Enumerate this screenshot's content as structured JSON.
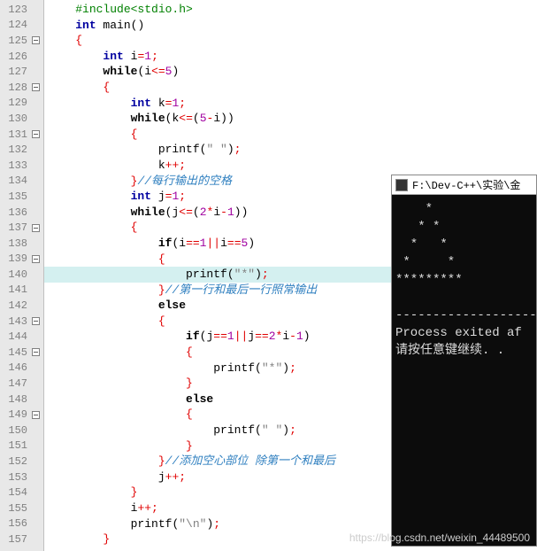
{
  "lines": [
    {
      "n": 123,
      "fold": false,
      "hl": false,
      "tokens": [
        [
          "    ",
          ""
        ],
        [
          "#include<stdio.h>",
          "preproc"
        ]
      ]
    },
    {
      "n": 124,
      "fold": false,
      "hl": false,
      "tokens": [
        [
          "    ",
          ""
        ],
        [
          "int",
          "type"
        ],
        [
          " main",
          ""
        ],
        [
          "()",
          "paren"
        ]
      ]
    },
    {
      "n": 125,
      "fold": true,
      "hl": false,
      "tokens": [
        [
          "    ",
          ""
        ],
        [
          "{",
          "brace"
        ]
      ]
    },
    {
      "n": 126,
      "fold": false,
      "hl": false,
      "tokens": [
        [
          "        ",
          ""
        ],
        [
          "int",
          "type"
        ],
        [
          " i",
          ""
        ],
        [
          "=",
          "op"
        ],
        [
          "1",
          "num"
        ],
        [
          ";",
          "op"
        ]
      ]
    },
    {
      "n": 127,
      "fold": false,
      "hl": false,
      "tokens": [
        [
          "        ",
          ""
        ],
        [
          "while",
          "keyword"
        ],
        [
          "(",
          "paren"
        ],
        [
          "i",
          ""
        ],
        [
          "<=",
          "op"
        ],
        [
          "5",
          "num"
        ],
        [
          ")",
          "paren"
        ]
      ]
    },
    {
      "n": 128,
      "fold": true,
      "hl": false,
      "tokens": [
        [
          "        ",
          ""
        ],
        [
          "{",
          "brace"
        ]
      ]
    },
    {
      "n": 129,
      "fold": false,
      "hl": false,
      "tokens": [
        [
          "            ",
          ""
        ],
        [
          "int",
          "type"
        ],
        [
          " k",
          ""
        ],
        [
          "=",
          "op"
        ],
        [
          "1",
          "num"
        ],
        [
          ";",
          "op"
        ]
      ]
    },
    {
      "n": 130,
      "fold": false,
      "hl": false,
      "tokens": [
        [
          "            ",
          ""
        ],
        [
          "while",
          "keyword"
        ],
        [
          "(",
          "paren"
        ],
        [
          "k",
          ""
        ],
        [
          "<=",
          "op"
        ],
        [
          "(",
          "paren"
        ],
        [
          "5",
          "num"
        ],
        [
          "-",
          "op"
        ],
        [
          "i",
          ""
        ],
        [
          ")",
          "paren"
        ],
        [
          ")",
          "paren"
        ]
      ]
    },
    {
      "n": 131,
      "fold": true,
      "hl": false,
      "tokens": [
        [
          "            ",
          ""
        ],
        [
          "{",
          "brace"
        ]
      ]
    },
    {
      "n": 132,
      "fold": false,
      "hl": false,
      "tokens": [
        [
          "                ",
          ""
        ],
        [
          "printf",
          ""
        ],
        [
          "(",
          "paren"
        ],
        [
          "\" \"",
          "str"
        ],
        [
          ")",
          "paren"
        ],
        [
          ";",
          "op"
        ]
      ]
    },
    {
      "n": 133,
      "fold": false,
      "hl": false,
      "tokens": [
        [
          "                ",
          ""
        ],
        [
          "k",
          ""
        ],
        [
          "++",
          "op"
        ],
        [
          ";",
          "op"
        ]
      ]
    },
    {
      "n": 134,
      "fold": false,
      "hl": false,
      "tokens": [
        [
          "            ",
          ""
        ],
        [
          "}",
          "brace"
        ],
        [
          "//每行输出的空格",
          "comment"
        ]
      ]
    },
    {
      "n": 135,
      "fold": false,
      "hl": false,
      "tokens": [
        [
          "            ",
          ""
        ],
        [
          "int",
          "type"
        ],
        [
          " j",
          ""
        ],
        [
          "=",
          "op"
        ],
        [
          "1",
          "num"
        ],
        [
          ";",
          "op"
        ]
      ]
    },
    {
      "n": 136,
      "fold": false,
      "hl": false,
      "tokens": [
        [
          "            ",
          ""
        ],
        [
          "while",
          "keyword"
        ],
        [
          "(",
          "paren"
        ],
        [
          "j",
          ""
        ],
        [
          "<=",
          "op"
        ],
        [
          "(",
          "paren"
        ],
        [
          "2",
          "num"
        ],
        [
          "*",
          "op"
        ],
        [
          "i",
          ""
        ],
        [
          "-",
          "op"
        ],
        [
          "1",
          "num"
        ],
        [
          ")",
          "paren"
        ],
        [
          ")",
          "paren"
        ]
      ]
    },
    {
      "n": 137,
      "fold": true,
      "hl": false,
      "tokens": [
        [
          "            ",
          ""
        ],
        [
          "{",
          "brace"
        ]
      ]
    },
    {
      "n": 138,
      "fold": false,
      "hl": false,
      "tokens": [
        [
          "                ",
          ""
        ],
        [
          "if",
          "keyword"
        ],
        [
          "(",
          "paren"
        ],
        [
          "i",
          ""
        ],
        [
          "==",
          "op"
        ],
        [
          "1",
          "num"
        ],
        [
          "||",
          "op"
        ],
        [
          "i",
          ""
        ],
        [
          "==",
          "op"
        ],
        [
          "5",
          "num"
        ],
        [
          ")",
          "paren"
        ]
      ]
    },
    {
      "n": 139,
      "fold": true,
      "hl": false,
      "tokens": [
        [
          "                ",
          ""
        ],
        [
          "{",
          "brace"
        ]
      ]
    },
    {
      "n": 140,
      "fold": false,
      "hl": true,
      "tokens": [
        [
          "                    ",
          ""
        ],
        [
          "printf",
          ""
        ],
        [
          "(",
          "paren"
        ],
        [
          "\"*\"",
          "str"
        ],
        [
          ")",
          "paren"
        ],
        [
          ";",
          "op"
        ]
      ]
    },
    {
      "n": 141,
      "fold": false,
      "hl": false,
      "tokens": [
        [
          "                ",
          ""
        ],
        [
          "}",
          "brace"
        ],
        [
          "//第一行和最后一行照常输出",
          "comment"
        ]
      ]
    },
    {
      "n": 142,
      "fold": false,
      "hl": false,
      "tokens": [
        [
          "                ",
          ""
        ],
        [
          "else",
          "keyword"
        ]
      ]
    },
    {
      "n": 143,
      "fold": true,
      "hl": false,
      "tokens": [
        [
          "                ",
          ""
        ],
        [
          "{",
          "brace"
        ]
      ]
    },
    {
      "n": 144,
      "fold": false,
      "hl": false,
      "tokens": [
        [
          "                    ",
          ""
        ],
        [
          "if",
          "keyword"
        ],
        [
          "(",
          "paren"
        ],
        [
          "j",
          ""
        ],
        [
          "==",
          "op"
        ],
        [
          "1",
          "num"
        ],
        [
          "||",
          "op"
        ],
        [
          "j",
          ""
        ],
        [
          "==",
          "op"
        ],
        [
          "2",
          "num"
        ],
        [
          "*",
          "op"
        ],
        [
          "i",
          ""
        ],
        [
          "-",
          "op"
        ],
        [
          "1",
          "num"
        ],
        [
          ")",
          "paren"
        ]
      ]
    },
    {
      "n": 145,
      "fold": true,
      "hl": false,
      "tokens": [
        [
          "                    ",
          ""
        ],
        [
          "{",
          "brace"
        ]
      ]
    },
    {
      "n": 146,
      "fold": false,
      "hl": false,
      "tokens": [
        [
          "                        ",
          ""
        ],
        [
          "printf",
          ""
        ],
        [
          "(",
          "paren"
        ],
        [
          "\"*\"",
          "str"
        ],
        [
          ")",
          "paren"
        ],
        [
          ";",
          "op"
        ]
      ]
    },
    {
      "n": 147,
      "fold": false,
      "hl": false,
      "tokens": [
        [
          "                    ",
          ""
        ],
        [
          "}",
          "brace"
        ]
      ]
    },
    {
      "n": 148,
      "fold": false,
      "hl": false,
      "tokens": [
        [
          "                    ",
          ""
        ],
        [
          "else",
          "keyword"
        ]
      ]
    },
    {
      "n": 149,
      "fold": true,
      "hl": false,
      "tokens": [
        [
          "                    ",
          ""
        ],
        [
          "{",
          "brace"
        ]
      ]
    },
    {
      "n": 150,
      "fold": false,
      "hl": false,
      "tokens": [
        [
          "                        ",
          ""
        ],
        [
          "printf",
          ""
        ],
        [
          "(",
          "paren"
        ],
        [
          "\" \"",
          "str"
        ],
        [
          ")",
          "paren"
        ],
        [
          ";",
          "op"
        ]
      ]
    },
    {
      "n": 151,
      "fold": false,
      "hl": false,
      "tokens": [
        [
          "                    ",
          ""
        ],
        [
          "}",
          "brace"
        ]
      ]
    },
    {
      "n": 152,
      "fold": false,
      "hl": false,
      "tokens": [
        [
          "                ",
          ""
        ],
        [
          "}",
          "brace"
        ],
        [
          "//添加空心部位 除第一个和最后",
          "comment"
        ]
      ]
    },
    {
      "n": 153,
      "fold": false,
      "hl": false,
      "tokens": [
        [
          "                ",
          ""
        ],
        [
          "j",
          ""
        ],
        [
          "++",
          "op"
        ],
        [
          ";",
          "op"
        ]
      ]
    },
    {
      "n": 154,
      "fold": false,
      "hl": false,
      "tokens": [
        [
          "            ",
          ""
        ],
        [
          "}",
          "brace"
        ]
      ]
    },
    {
      "n": 155,
      "fold": false,
      "hl": false,
      "tokens": [
        [
          "            ",
          ""
        ],
        [
          "i",
          ""
        ],
        [
          "++",
          "op"
        ],
        [
          ";",
          "op"
        ]
      ]
    },
    {
      "n": 156,
      "fold": false,
      "hl": false,
      "tokens": [
        [
          "            ",
          ""
        ],
        [
          "printf",
          ""
        ],
        [
          "(",
          "paren"
        ],
        [
          "\"\\n\"",
          "str"
        ],
        [
          ")",
          "paren"
        ],
        [
          ";",
          "op"
        ]
      ]
    },
    {
      "n": 157,
      "fold": false,
      "hl": false,
      "tokens": [
        [
          "        ",
          ""
        ],
        [
          "}",
          "brace"
        ]
      ]
    }
  ],
  "console": {
    "title": "F:\\Dev-C++\\实验\\金",
    "output_lines": [
      "    *",
      "   * *",
      "  *   *",
      " *     *",
      "*********",
      "",
      "--------------------",
      "Process exited af",
      "请按任意键继续. ."
    ]
  },
  "watermark": "https://blog.csdn.net/weixin_44489500"
}
